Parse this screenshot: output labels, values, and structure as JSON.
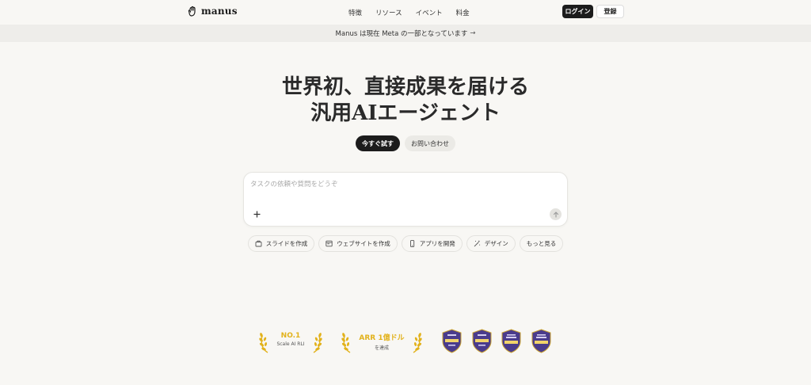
{
  "nav": {
    "brand": "manus",
    "links": [
      "特徴",
      "リソース",
      "イベント",
      "料金"
    ],
    "login": "ログイン",
    "signup": "登録"
  },
  "banner": {
    "text": "Manus は現在 Meta の一部となっています",
    "arrow": "→"
  },
  "hero": {
    "line1": "世界初、直接成果を届ける",
    "line2": "汎用AIエージェント"
  },
  "cta": {
    "primary": "今すぐ試す",
    "secondary": "お問い合わせ"
  },
  "composer": {
    "placeholder": "タスクの依頼や質問をどうぞ",
    "value": ""
  },
  "chips": [
    {
      "label": "スライドを作成",
      "icon": "presentation-icon"
    },
    {
      "label": "ウェブサイトを作成",
      "icon": "browser-window-icon"
    },
    {
      "label": "アプリを開発",
      "icon": "smartphone-icon"
    },
    {
      "label": "デザイン",
      "icon": "magic-wand-icon"
    },
    {
      "label": "もっと見る",
      "icon": ""
    }
  ],
  "awards": [
    {
      "title": "NO.1",
      "sub": "Scale AI RLI"
    },
    {
      "title": "ARR 1億ドル",
      "sub": "を達成"
    }
  ],
  "badges": [
    "soc2-type1-badge",
    "soc2-type2-badge",
    "iso-27001-badge",
    "iso-27701-badge"
  ],
  "colors": {
    "background": "#f8f7f4",
    "primary_button": "#1c1c1c",
    "award_gold": "#e2b21c",
    "badge_purple": "#4a3b8c"
  }
}
